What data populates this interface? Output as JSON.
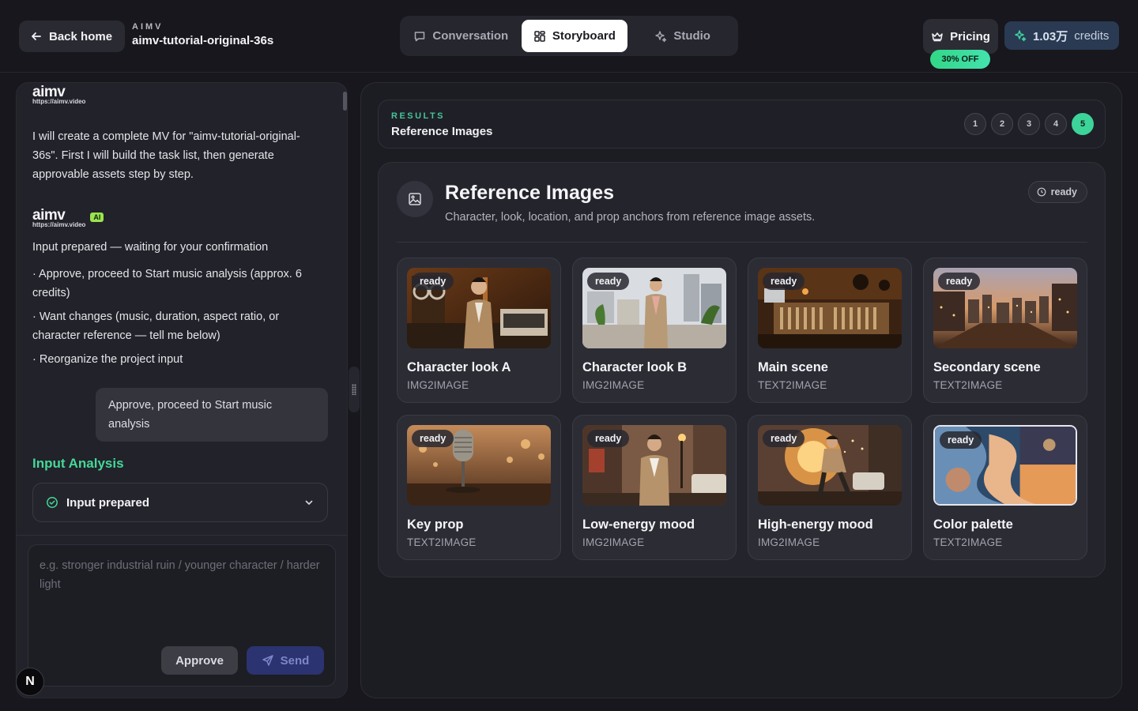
{
  "topbar": {
    "back_label": "Back home",
    "brand_small": "AIMV",
    "project_name": "aimv-tutorial-original-36s",
    "tabs": [
      {
        "label": "Conversation",
        "icon": "chat-bubble-icon",
        "active": false
      },
      {
        "label": "Storyboard",
        "icon": "grid-icon",
        "active": true
      },
      {
        "label": "Studio",
        "icon": "sparkle-icon",
        "active": false
      }
    ],
    "pricing_label": "Pricing",
    "discount_label": "30% OFF",
    "credits_value": "1.03万",
    "credits_unit": "credits"
  },
  "chat": {
    "logo_text": "aimv",
    "logo_url": "https://aimv.video",
    "ai_tag": "AI",
    "intro_message": "I will create a complete MV for \"aimv-tutorial-original-36s\". First I will build the task list, then generate approvable assets step by step.",
    "status_message": "Input prepared — waiting for your confirmation",
    "options": [
      "· Approve, proceed to Start music analysis (approx. 6 credits)",
      "· Want changes (music, duration, aspect ratio, or character reference — tell me below)",
      "· Reorganize the project input"
    ],
    "user_reply": "Approve, proceed to Start music analysis",
    "section_title": "Input Analysis",
    "collapse_label": "Input prepared",
    "composer_placeholder": "e.g. stronger industrial ruin / younger character / harder light",
    "approve_label": "Approve",
    "send_label": "Send",
    "n_badge": "N"
  },
  "results": {
    "label": "RESULTS",
    "title": "Reference Images",
    "steps": [
      "1",
      "2",
      "3",
      "4",
      "5"
    ],
    "active_step": "5"
  },
  "reference": {
    "title": "Reference Images",
    "subtitle": "Character, look, location, and prop anchors from reference image assets.",
    "status": "ready",
    "items": [
      {
        "title": "Character look A",
        "type": "IMG2IMAGE",
        "status": "ready"
      },
      {
        "title": "Character look B",
        "type": "IMG2IMAGE",
        "status": "ready"
      },
      {
        "title": "Main scene",
        "type": "TEXT2IMAGE",
        "status": "ready"
      },
      {
        "title": "Secondary scene",
        "type": "TEXT2IMAGE",
        "status": "ready"
      },
      {
        "title": "Key prop",
        "type": "TEXT2IMAGE",
        "status": "ready"
      },
      {
        "title": "Low-energy mood",
        "type": "IMG2IMAGE",
        "status": "ready"
      },
      {
        "title": "High-energy mood",
        "type": "IMG2IMAGE",
        "status": "ready"
      },
      {
        "title": "Color palette",
        "type": "TEXT2IMAGE",
        "status": "ready"
      }
    ]
  },
  "colors": {
    "accent_green": "#45d898",
    "active_step": "#3dd49a",
    "send_button": "#2b3370",
    "credits_bg": "#2a3a52"
  }
}
